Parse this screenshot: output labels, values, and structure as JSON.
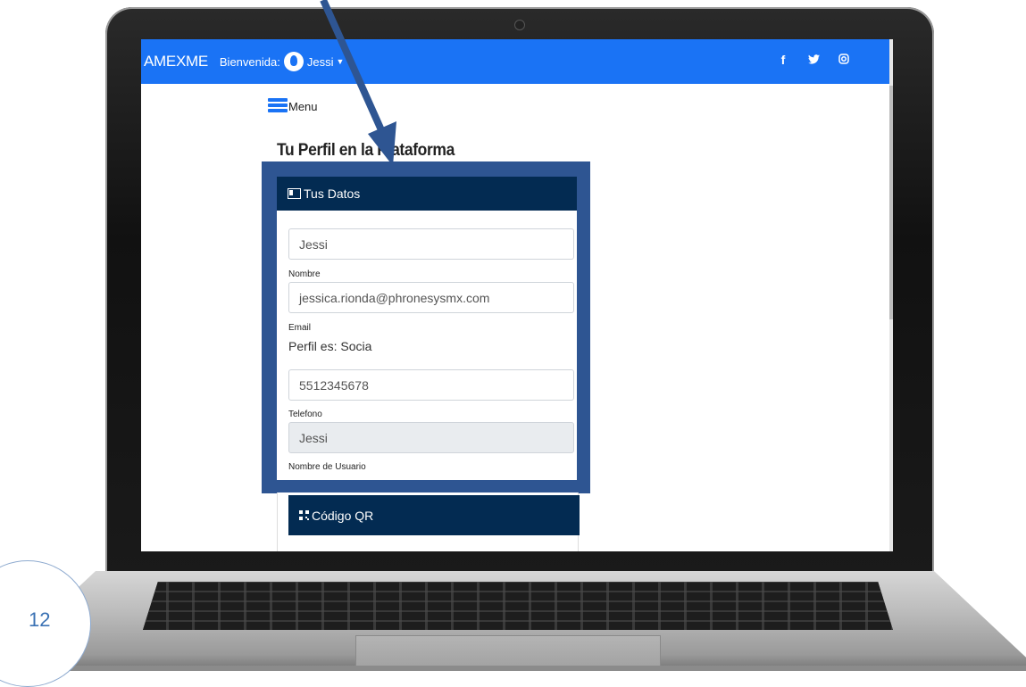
{
  "app": {
    "brand": "AMEXME",
    "welcome_label": "Bienvenida:",
    "user_name": "Jessi",
    "social_icons": [
      "facebook-icon",
      "twitter-icon",
      "instagram-icon"
    ]
  },
  "social_glyphs": {
    "facebook": "f",
    "twitter": "🐦",
    "instagram": "◎"
  },
  "menu": {
    "label": "Menu"
  },
  "page": {
    "title": "Tu Perfil en la Plataforma"
  },
  "profile_card": {
    "header": "Tus Datos",
    "fields": {
      "name_value": "Jessi",
      "name_label": "Nombre",
      "email_value": "jessica.rionda@phronesysmx.com",
      "email_label": "Email",
      "profile_text": "Perfil es: Socia",
      "phone_value": "5512345678",
      "phone_label": "Telefono",
      "username_value": "Jessi",
      "username_label": "Nombre de Usuario"
    }
  },
  "qr_card": {
    "header": "Código QR"
  },
  "document": {
    "page_number": "12"
  },
  "colors": {
    "navbar": "#1a73f5",
    "card_header": "#032b52",
    "highlight_frame": "#2e5592",
    "arrow": "#2e5592"
  }
}
